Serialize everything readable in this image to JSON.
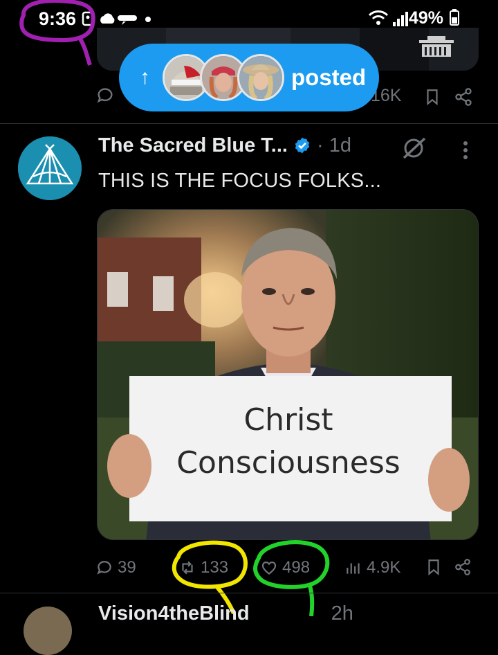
{
  "status_bar": {
    "time": "9:36",
    "battery": "49%"
  },
  "top_post": {
    "views": "16K"
  },
  "posted_pill": {
    "label": "posted",
    "accent": "#1d9bf0"
  },
  "post": {
    "display_name": "The Sacred Blue T...",
    "time": "· 1d",
    "text": "THIS IS THE FOCUS FOLKS...",
    "image": {
      "sign_line1": "Christ",
      "sign_line2": "Consciousness"
    },
    "stats": {
      "replies": "39",
      "reposts": "133",
      "likes": "498",
      "views": "4.9K"
    }
  },
  "next_post": {
    "display_name": "Vision4theBlind",
    "time": "2h"
  },
  "colors": {
    "background": "#000000",
    "text": "#e7e9ea",
    "muted": "#71767b",
    "verified": "#1d9bf0",
    "annotation_purple": "#a020b0",
    "annotation_yellow": "#f2e600",
    "annotation_green": "#22d22a"
  }
}
